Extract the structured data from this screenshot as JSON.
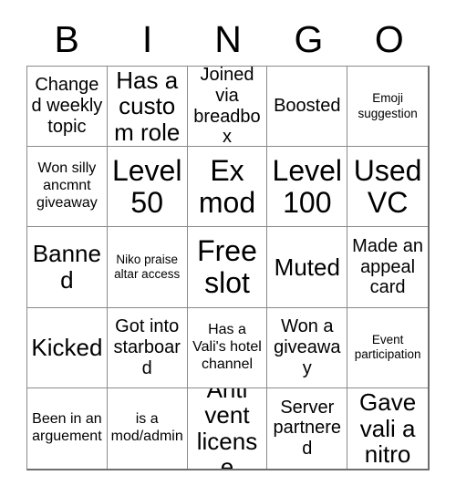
{
  "card": {
    "title": "BINGO",
    "header_letters": [
      "B",
      "I",
      "N",
      "G",
      "O"
    ],
    "rows": 5,
    "columns": 5,
    "colors": {
      "text": "#000000",
      "background": "#ffffff",
      "grid_line": "#8a8a8a",
      "grid_outer": "#6e6e6e"
    },
    "cells": [
      {
        "text": "Changed weekly topic",
        "size": "s-md"
      },
      {
        "text": "Has a custom role",
        "size": "s-lg"
      },
      {
        "text": "Joined via breadbox",
        "size": "s-md"
      },
      {
        "text": "Boosted",
        "size": "s-md"
      },
      {
        "text": "Emoji suggestion",
        "size": "s-xs"
      },
      {
        "text": "Won silly ancmnt giveaway",
        "size": "s-sm"
      },
      {
        "text": "Level 50",
        "size": "s-xl"
      },
      {
        "text": "Ex mod",
        "size": "s-xl"
      },
      {
        "text": "Level 100",
        "size": "s-xl"
      },
      {
        "text": "Used VC",
        "size": "s-xl"
      },
      {
        "text": "Banned",
        "size": "s-lg"
      },
      {
        "text": "Niko praise altar access",
        "size": "s-xs"
      },
      {
        "text": "Free slot",
        "size": "s-xl"
      },
      {
        "text": "Muted",
        "size": "s-lg"
      },
      {
        "text": "Made an appeal card",
        "size": "s-md"
      },
      {
        "text": "Kicked",
        "size": "s-lg"
      },
      {
        "text": "Got into starboard",
        "size": "s-md"
      },
      {
        "text": "Has a Vali's hotel channel",
        "size": "s-sm"
      },
      {
        "text": "Won a giveaway",
        "size": "s-md"
      },
      {
        "text": "Event participation",
        "size": "s-xs"
      },
      {
        "text": "Been in an arguement",
        "size": "s-sm"
      },
      {
        "text": "is a mod/admin",
        "size": "s-sm"
      },
      {
        "text": "Anti vent license",
        "size": "s-lg"
      },
      {
        "text": "Server partnered",
        "size": "s-md"
      },
      {
        "text": "Gave vali a nitro",
        "size": "s-lg"
      }
    ]
  }
}
